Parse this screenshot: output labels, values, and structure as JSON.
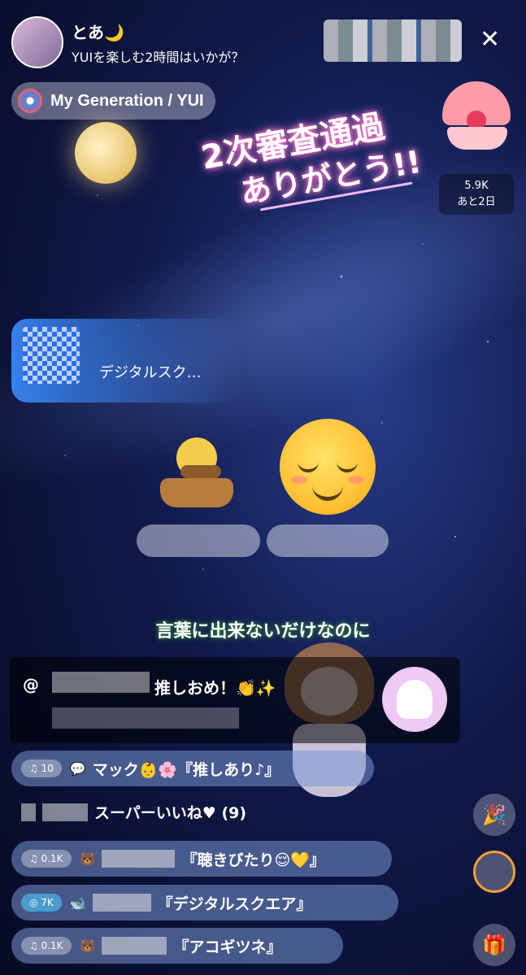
{
  "streamer": {
    "name": "とあ🌙",
    "subtitle": "YUIを楽しむ2時間はいかが？"
  },
  "close_label": "✕",
  "music": {
    "label": "My Generation / YUI"
  },
  "banner": {
    "line1": "2次審査通過",
    "line2": "ありがとう!!"
  },
  "ranking": {
    "count": "5.9K",
    "remaining": "あと2日"
  },
  "gift_notice": {
    "name": "デジタルスク…"
  },
  "caption": "言葉に出来ないだけなのに",
  "super_message": {
    "at": "@",
    "text": "推しおめ！👏✨"
  },
  "chat": [
    {
      "badge": "♫ 10",
      "icon": "💬",
      "text": "マック👶🌸『推しあり♪』"
    },
    {
      "badge": "♫ 0.1K",
      "icon": "🐻",
      "text": "『聴きびたり😌💛』"
    },
    {
      "badge": "◎ 7K",
      "icon": "🐋",
      "text": "『デジタルスクエア』"
    },
    {
      "badge": "♫ 0.1K",
      "icon": "🐻",
      "text": "『アコギツネ』"
    }
  ],
  "like_text": "スーパーいいね♥ (9)",
  "icons": {
    "party": "🎉",
    "gift": "🎁"
  }
}
